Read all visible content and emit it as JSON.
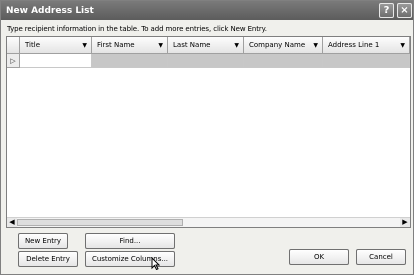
{
  "window": {
    "title": "New Address List",
    "help_label": "?",
    "close_label": "×"
  },
  "instruction": "Type recipient information in the table.  To add more entries, click New Entry.",
  "table": {
    "columns": [
      "Title",
      "First Name",
      "Last Name",
      "Company Name",
      "Address Line 1"
    ],
    "row_marker": "▷",
    "dropdown_glyph": "▼"
  },
  "scrollbar": {
    "left_arrow": "◀",
    "right_arrow": "▶"
  },
  "buttons": {
    "new_entry": "New Entry",
    "find": "Find...",
    "delete_entry": "Delete Entry",
    "customize_columns": "Customize Columns...",
    "ok": "OK",
    "cancel": "Cancel"
  }
}
